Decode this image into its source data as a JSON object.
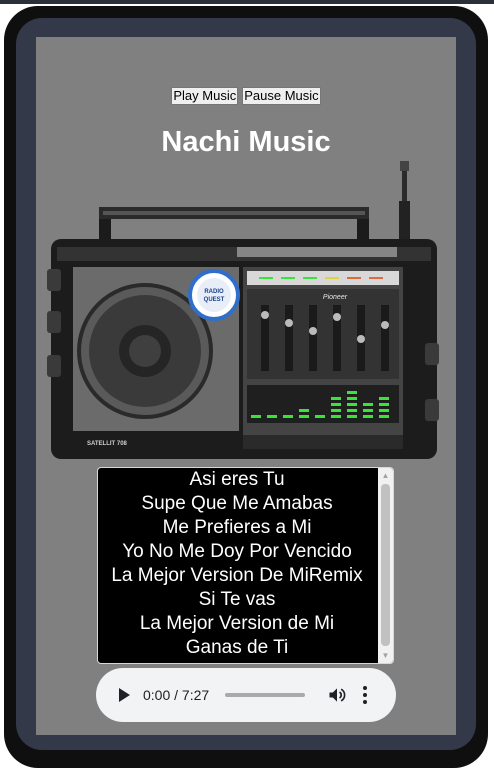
{
  "controls": {
    "play_label": "Play Music",
    "pause_label": "Pause Music"
  },
  "header": {
    "title": "Nachi Music"
  },
  "radio": {
    "logo_text": "RADIO QUEST",
    "brand_text": "Pioneer",
    "model_text": "SATELLIT 708"
  },
  "playlist": {
    "items": [
      "Asi eres Tu",
      "Supe Que Me Amabas",
      "Me Prefieres a Mi",
      "Yo No Me Doy Por Vencido",
      "La Mejor Version De MiRemix",
      "Si Te vas",
      "La Mejor Version de Mi",
      "Ganas de Ti"
    ]
  },
  "player": {
    "time_display": "0:00 / 7:27",
    "progress": 0,
    "icons": [
      "play-icon",
      "volume-icon",
      "more-vert-icon"
    ]
  },
  "colors": {
    "screen_bg": "#808080",
    "frame": "#0f0f10",
    "frame_ring": "#34394a",
    "title": "#ffffff",
    "playlist_bg": "#000000",
    "player_bg": "#f1f3f4",
    "eq_green": "#37e43a"
  }
}
